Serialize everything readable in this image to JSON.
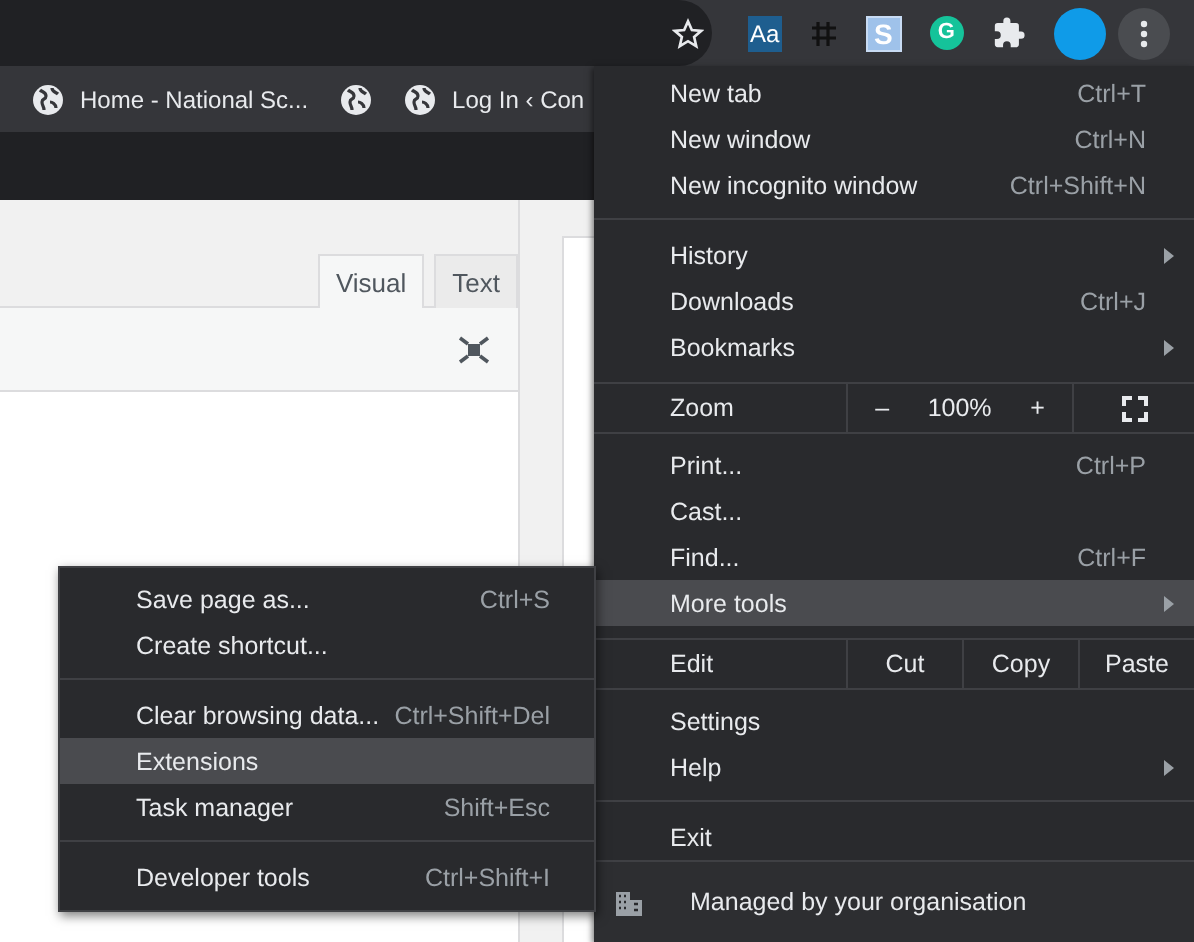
{
  "toolbar": {
    "extensions": [
      {
        "kind": "dictionary",
        "text": "Aa"
      },
      {
        "kind": "grid"
      },
      {
        "kind": "letter",
        "text": "S"
      },
      {
        "kind": "grammar",
        "text": "G"
      },
      {
        "kind": "puzzle"
      }
    ]
  },
  "bookmarks": [
    {
      "kind": "labeled",
      "label": "Home - National Sc..."
    },
    {
      "kind": "icon_only"
    },
    {
      "kind": "labeled",
      "label": "Log In ‹ Con"
    }
  ],
  "editor": {
    "tabs": [
      {
        "label": "Visual",
        "selected": true
      },
      {
        "label": "Text",
        "selected": false
      }
    ]
  },
  "menu": {
    "items": [
      {
        "kind": "item",
        "label": "New tab",
        "shortcut": "Ctrl+T",
        "submenu": false,
        "selected": false
      },
      {
        "kind": "item",
        "label": "New window",
        "shortcut": "Ctrl+N",
        "submenu": false,
        "selected": false
      },
      {
        "kind": "item",
        "label": "New incognito window",
        "shortcut": "Ctrl+Shift+N",
        "submenu": false,
        "selected": false
      },
      {
        "kind": "separator"
      },
      {
        "kind": "item",
        "label": "History",
        "submenu": true,
        "selected": false
      },
      {
        "kind": "item",
        "label": "Downloads",
        "shortcut": "Ctrl+J",
        "submenu": false,
        "selected": false
      },
      {
        "kind": "item",
        "label": "Bookmarks",
        "submenu": true,
        "selected": false
      },
      {
        "kind": "zoom",
        "label": "Zoom",
        "minus": "–",
        "value": "100%",
        "plus": "+"
      },
      {
        "kind": "item",
        "label": "Print...",
        "shortcut": "Ctrl+P",
        "submenu": false,
        "selected": false
      },
      {
        "kind": "item",
        "label": "Cast...",
        "submenu": false,
        "selected": false
      },
      {
        "kind": "item",
        "label": "Find...",
        "shortcut": "Ctrl+F",
        "submenu": false,
        "selected": false
      },
      {
        "kind": "item",
        "label": "More tools",
        "submenu": true,
        "selected": true
      },
      {
        "kind": "edit",
        "label": "Edit",
        "buttons": [
          "Cut",
          "Copy",
          "Paste"
        ]
      },
      {
        "kind": "item",
        "label": "Settings",
        "submenu": false,
        "selected": false
      },
      {
        "kind": "item",
        "label": "Help",
        "submenu": true,
        "selected": false
      },
      {
        "kind": "separator"
      },
      {
        "kind": "item",
        "label": "Exit",
        "submenu": false,
        "selected": false
      }
    ],
    "footer": "Managed by your organisation"
  },
  "submenu": {
    "items": [
      {
        "kind": "item",
        "label": "Save page as...",
        "shortcut": "Ctrl+S",
        "selected": false
      },
      {
        "kind": "item",
        "label": "Create shortcut...",
        "selected": false
      },
      {
        "kind": "separator"
      },
      {
        "kind": "item",
        "label": "Clear browsing data...",
        "shortcut": "Ctrl+Shift+Del",
        "selected": false
      },
      {
        "kind": "item",
        "label": "Extensions",
        "selected": true
      },
      {
        "kind": "item",
        "label": "Task manager",
        "shortcut": "Shift+Esc",
        "selected": false
      },
      {
        "kind": "separator"
      },
      {
        "kind": "item",
        "label": "Developer tools",
        "shortcut": "Ctrl+Shift+I",
        "selected": false
      }
    ]
  }
}
